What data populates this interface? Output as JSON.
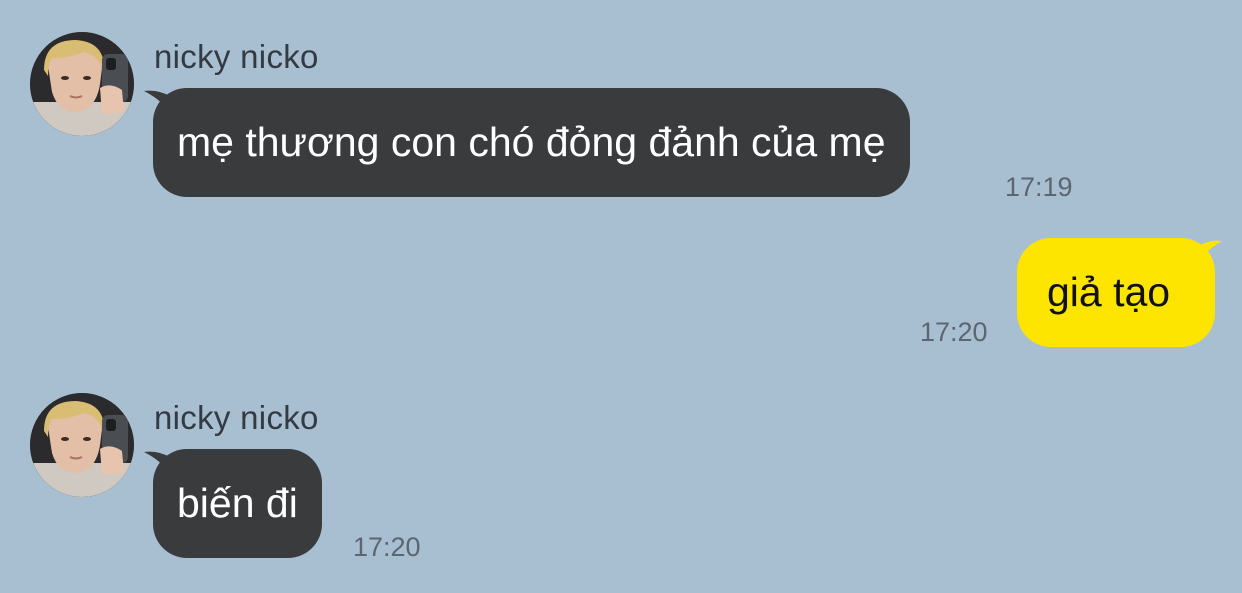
{
  "messages": [
    {
      "sender": "nicky nicko",
      "direction": "incoming",
      "text": "mẹ thương con chó đỏng đảnh của mẹ",
      "time": "17:19"
    },
    {
      "sender": "",
      "direction": "outgoing",
      "text": "giả tạo",
      "time": "17:20"
    },
    {
      "sender": "nicky nicko",
      "direction": "incoming",
      "text": "biến đi",
      "time": "17:20"
    }
  ],
  "colors": {
    "background": "#a8bfd2",
    "incoming_bubble": "#3a3b3d",
    "outgoing_bubble": "#fee500",
    "timestamp": "#5c6670"
  }
}
